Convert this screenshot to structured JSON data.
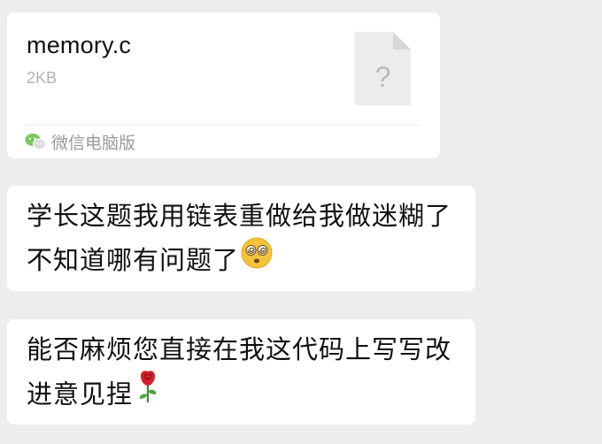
{
  "file_message": {
    "file_name": "memory.c",
    "file_size": "2KB",
    "file_icon_glyph": "?",
    "source_label": "微信电脑版",
    "source_icon": "wechat-icon"
  },
  "messages": [
    {
      "text": "学长这题我用链表重做给我做迷糊了不知道哪有问题了",
      "trailing_emoji": "dizzy-face-emoji"
    },
    {
      "text": "能否麻烦您直接在我这代码上写写改进意见捏",
      "trailing_emoji": "rose-emoji"
    }
  ],
  "colors": {
    "background": "#ededed",
    "bubble": "#ffffff",
    "text": "#111111",
    "muted": "#b2b2b2"
  }
}
